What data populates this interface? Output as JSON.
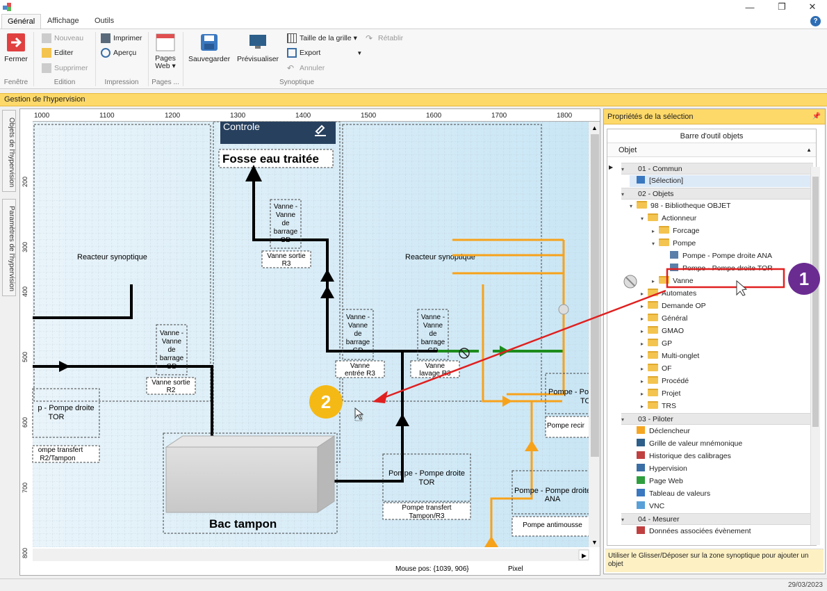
{
  "window": {
    "minimize": "—",
    "restore": "❐",
    "close": "✕"
  },
  "tabs": [
    "Général",
    "Affichage",
    "Outils"
  ],
  "ribbon": {
    "fenetre": {
      "fermer": "Fermer",
      "label": "Fenêtre"
    },
    "edition": {
      "nouveau": "Nouveau",
      "editer": "Editer",
      "supprimer": "Supprimer",
      "label": "Edition"
    },
    "impression": {
      "imprimer": "Imprimer",
      "apercu": "Aperçu",
      "label": "Impression"
    },
    "pages": {
      "btn": "Pages Web ▾",
      "label": "Pages ..."
    },
    "synoptique": {
      "sauvegarder": "Sauvegarder",
      "previsualiser": "Prévisualiser",
      "taille": "Taille de la grille ▾",
      "export": "Export",
      "annuler": "Annuler",
      "retablir": "Rétablir",
      "label": "Synoptique"
    }
  },
  "help": "?",
  "title_bar": "Gestion de l'hypervision",
  "sidetabs": [
    "Objets de l'hypervision",
    "Paramètres de l'hypervision"
  ],
  "ruler": {
    "h": [
      "1000",
      "1100",
      "1200",
      "1300",
      "1400",
      "1500",
      "1600",
      "1700",
      "1800"
    ],
    "v": [
      "200",
      "300",
      "400",
      "500",
      "600",
      "700",
      "800"
    ]
  },
  "canvas": {
    "controle": "Controle",
    "fosse": "Fosse eau traitée",
    "reacteur1": "Reacteur synoptique",
    "reacteur2": "Reacteur synoptique",
    "vanne_r3": [
      "Vanne -",
      "Vanne",
      "de",
      "barrage",
      "GD"
    ],
    "vanne_sortie_r3": [
      "Vanne sortie",
      "R3"
    ],
    "vanne_r2": [
      "Vanne -",
      "Vanne",
      "de",
      "barrage",
      "GD"
    ],
    "vanne_sortie_r2": [
      "Vanne sortie",
      "R2"
    ],
    "vanne_entree": [
      "Vanne -",
      "Vanne",
      "de",
      "barrage",
      "GD"
    ],
    "vanne_entree_lbl": [
      "Vanne",
      "entrée R3"
    ],
    "vanne_lavage": [
      "Vanne -",
      "Vanne",
      "de",
      "barrage",
      "GD"
    ],
    "vanne_lavage_lbl": [
      "Vanne",
      "lavage R3"
    ],
    "pompe_left": [
      "p - Pompe droite",
      "TOR"
    ],
    "pompe_left_lbl": [
      "ompe transfert",
      "R2/Tampon"
    ],
    "pompe_center": [
      "Pompe - Pompe droite",
      "TOR"
    ],
    "pompe_center_lbl": [
      "Pompe transfert",
      "Tampon/R3"
    ],
    "pompe_right": [
      "Pompe - Po",
      "TO"
    ],
    "pompe_right_lbl": "Pompe recir",
    "pompe_ana": [
      "Pompe - Pompe droite",
      "ANA"
    ],
    "pompe_anti": "Pompe antimousse",
    "bac": "Bac tampon"
  },
  "status": {
    "mouse": "Mouse pos: {1039, 906}",
    "unit": "Pixel",
    "date": "29/03/2023"
  },
  "panel": {
    "title": "Propriétés de la sélection",
    "pin": "📌",
    "toolbar": "Barre d'outil objets",
    "col": "Objet",
    "tree": [
      {
        "t": "01 - Commun",
        "lvl": 0,
        "group": true,
        "exp": "▾"
      },
      {
        "t": "[Sélection]",
        "lvl": 1,
        "icon": "cursor",
        "sel": true
      },
      {
        "t": "02 - Objets",
        "lvl": 0,
        "group": true,
        "exp": "▾"
      },
      {
        "t": "98 - Bibliotheque OBJET",
        "lvl": 1,
        "folder": true,
        "exp": "▾"
      },
      {
        "t": "Actionneur",
        "lvl": 2,
        "folder": true,
        "exp": "▾"
      },
      {
        "t": "Forcage",
        "lvl": 3,
        "folder": true,
        "exp": "▸"
      },
      {
        "t": "Pompe",
        "lvl": 3,
        "folder": true,
        "exp": "▾"
      },
      {
        "t": "Pompe - Pompe droite ANA",
        "lvl": 4,
        "icon": "obj"
      },
      {
        "t": "Pompe - Pompe droite TOR",
        "lvl": 4,
        "icon": "obj",
        "hl": true
      },
      {
        "t": "Vanne",
        "lvl": 3,
        "folder": true,
        "exp": "▸"
      },
      {
        "t": "Automates",
        "lvl": 2,
        "folder": true,
        "exp": "▸"
      },
      {
        "t": "Demande OP",
        "lvl": 2,
        "folder": true,
        "exp": "▸"
      },
      {
        "t": "Général",
        "lvl": 2,
        "folder": true,
        "exp": "▸"
      },
      {
        "t": "GMAO",
        "lvl": 2,
        "folder": true,
        "exp": "▸"
      },
      {
        "t": "GP",
        "lvl": 2,
        "folder": true,
        "exp": "▸"
      },
      {
        "t": "Multi-onglet",
        "lvl": 2,
        "folder": true,
        "exp": "▸"
      },
      {
        "t": "OF",
        "lvl": 2,
        "folder": true,
        "exp": "▸"
      },
      {
        "t": "Procédé",
        "lvl": 2,
        "folder": true,
        "exp": "▸"
      },
      {
        "t": "Projet",
        "lvl": 2,
        "folder": true,
        "exp": "▸"
      },
      {
        "t": "TRS",
        "lvl": 2,
        "folder": true,
        "exp": "▸"
      },
      {
        "t": "03 - Piloter",
        "lvl": 0,
        "group": true,
        "exp": "▾"
      },
      {
        "t": "Déclencheur",
        "lvl": 1,
        "icon": "bolt"
      },
      {
        "t": "Grille de valeur mnémonique",
        "lvl": 1,
        "icon": "grid"
      },
      {
        "t": "Historique des calibrages",
        "lvl": 1,
        "icon": "list"
      },
      {
        "t": "Hypervision",
        "lvl": 1,
        "icon": "hyp"
      },
      {
        "t": "Page Web",
        "lvl": 1,
        "icon": "web"
      },
      {
        "t": "Tableau de valeurs",
        "lvl": 1,
        "icon": "table"
      },
      {
        "t": "VNC",
        "lvl": 1,
        "icon": "vnc"
      },
      {
        "t": "04 - Mesurer",
        "lvl": 0,
        "group": true,
        "exp": "▾"
      },
      {
        "t": "Données associées évènement",
        "lvl": 1,
        "icon": "data"
      }
    ],
    "hint": "Utiliser le Glisser/Déposer sur la zone synoptique pour ajouter un objet"
  },
  "badges": [
    "1",
    "2"
  ],
  "colors": {
    "accent": "#fdd96a",
    "pipe": "#f7a21b",
    "green": "#1c8c1c",
    "arrow": "#e02020",
    "badge1": "#6a2c91",
    "badge2": "#f5b915"
  }
}
